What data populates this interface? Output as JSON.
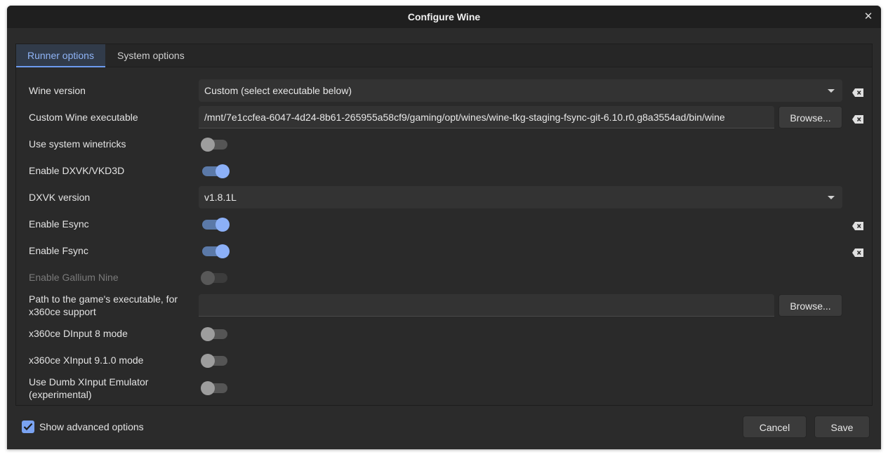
{
  "window": {
    "title": "Configure Wine"
  },
  "tabs": [
    {
      "label": "Runner options",
      "active": true
    },
    {
      "label": "System options",
      "active": false
    }
  ],
  "options": {
    "wine_version": {
      "label": "Wine version",
      "value": "Custom (select executable below)"
    },
    "custom_exec": {
      "label": "Custom Wine executable",
      "value": "/mnt/7e1ccfea-6047-4d24-8b61-265955a58cf9/gaming/opt/wines/wine-tkg-staging-fsync-git-6.10.r0.g8a3554ad/bin/wine",
      "button": "Browse..."
    },
    "system_winetricks": {
      "label": "Use system winetricks",
      "on": false
    },
    "dxvk": {
      "label": "Enable DXVK/VKD3D",
      "on": true
    },
    "dxvk_version": {
      "label": "DXVK version",
      "value": "v1.8.1L"
    },
    "esync": {
      "label": "Enable Esync",
      "on": true
    },
    "fsync": {
      "label": "Enable Fsync",
      "on": true
    },
    "gallium_nine": {
      "label": "Enable Gallium Nine",
      "on": false,
      "disabled": true
    },
    "x360ce_path": {
      "label": "Path to the game's executable, for x360ce support",
      "value": "",
      "button": "Browse..."
    },
    "x360ce_dinput": {
      "label": "x360ce DInput 8 mode",
      "on": false
    },
    "x360ce_xinput": {
      "label": "x360ce XInput 9.1.0 mode",
      "on": false
    },
    "dumb_xinput": {
      "label": "Use Dumb XInput Emulator (experimental)",
      "on": false
    }
  },
  "footer": {
    "show_advanced": {
      "label": "Show advanced options",
      "checked": true
    },
    "cancel": "Cancel",
    "save": "Save"
  },
  "colors": {
    "accent": "#8cb0f7",
    "background": "#2b2b2b",
    "titlebar": "#1f1f1f"
  },
  "icons": {
    "close": "close-icon",
    "reset": "reset-clear-icon",
    "dropdown": "chevron-down-icon",
    "check": "checkmark-icon"
  }
}
